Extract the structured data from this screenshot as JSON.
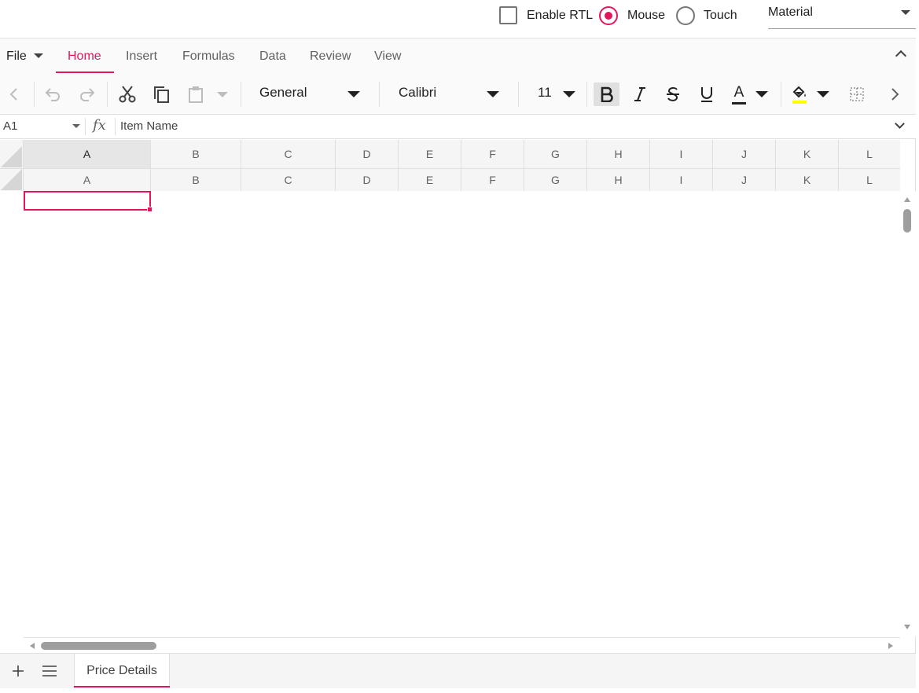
{
  "settings": {
    "enable_rtl_label": "Enable RTL",
    "mode_mouse_label": "Mouse",
    "mode_touch_label": "Touch",
    "theme_value": "Material"
  },
  "ribbon": {
    "file_label": "File",
    "tabs": [
      {
        "label": "Home",
        "active": true
      },
      {
        "label": "Insert"
      },
      {
        "label": "Formulas"
      },
      {
        "label": "Data"
      },
      {
        "label": "Review"
      },
      {
        "label": "View"
      }
    ]
  },
  "toolbar": {
    "number_format": "General",
    "font_name": "Calibri",
    "font_size": "11",
    "font_color_glyph": "A",
    "icons": [
      "chevron-left-icon",
      "undo-icon",
      "redo-icon",
      "cut-icon",
      "copy-icon",
      "paste-icon",
      "bold-icon",
      "italic-icon",
      "strikethrough-icon",
      "underline-icon",
      "font-color-icon",
      "fill-color-icon",
      "borders-icon",
      "chevron-right-icon"
    ],
    "accent_color": "#e3165b",
    "fill_color_swatch": "#ffff00"
  },
  "formula_bar": {
    "name_box": "A1",
    "fx_label": "fx",
    "value": "Item Name"
  },
  "columns": [
    "A",
    "B",
    "C",
    "D",
    "E",
    "F",
    "G",
    "H",
    "I",
    "J",
    "K",
    "L"
  ],
  "sheets": [
    {
      "label": "Price Details",
      "active": true
    }
  ]
}
